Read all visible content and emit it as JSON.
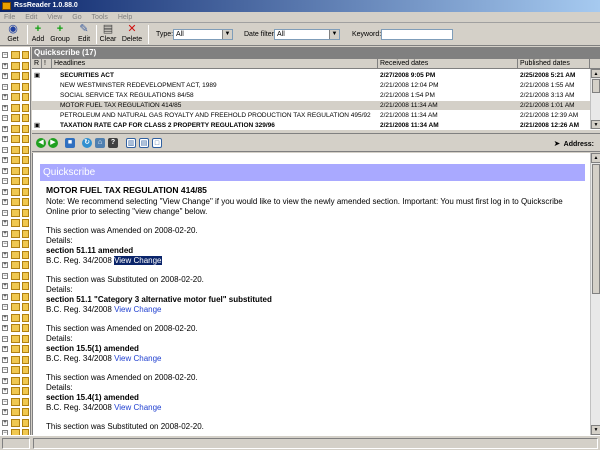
{
  "window": {
    "title": "RssReader 1.0.88.0"
  },
  "menu": [
    "File",
    "Edit",
    "View",
    "Go",
    "Tools",
    "Help"
  ],
  "toolbar": {
    "get": "Get",
    "add": "Add",
    "group": "Group",
    "edit": "Edit",
    "clear": "Clear",
    "delete": "Delete",
    "type_label": "Type:",
    "type_value": "All",
    "datefilter_label": "Date filter:",
    "datefilter_value": "All",
    "keyword_label": "Keyword:"
  },
  "feed_panel": {
    "title": "Quickscribe (17)"
  },
  "grid": {
    "columns": [
      "R",
      "!",
      "Headlines",
      "Received dates",
      "Published dates"
    ],
    "rows": [
      {
        "headline": "SECURITIES ACT",
        "received": "2/27/2008 9:05 PM",
        "published": "2/25/2008 5:21 AM"
      },
      {
        "headline": "NEW WESTMINSTER REDEVELOPMENT ACT, 1989",
        "received": "2/21/2008 12:04 PM",
        "published": "2/21/2008 1:55 AM"
      },
      {
        "headline": "SOCIAL SERVICE TAX REGULATIONS 84/58",
        "received": "2/21/2008 1:54 PM",
        "published": "2/21/2008 3:13 AM"
      },
      {
        "headline": "MOTOR FUEL TAX REGULATION 414/85",
        "received": "2/21/2008 11:34 AM",
        "published": "2/21/2008 1:01 AM"
      },
      {
        "headline": "PETROLEUM AND NATURAL GAS ROYALTY AND FREEHOLD PRODUCTION TAX REGULATION 495/92",
        "received": "2/21/2008 11:34 AM",
        "published": "2/21/2008 12:39 AM"
      },
      {
        "headline": "TAXATION RATE CAP FOR CLASS 2 PROPERTY REGULATION 329/96",
        "received": "2/21/2008 11:34 AM",
        "published": "2/21/2008 12:26 AM"
      }
    ]
  },
  "browser": {
    "address_label": "Address:"
  },
  "article": {
    "banner": "Quickscribe",
    "title": "MOTOR FUEL TAX REGULATION 414/85",
    "note": "Note: We recommend selecting \"View Change\" if you would like to view the newly amended section. Important: You must first log in to Quickscribe Online prior to selecting \"view change\" below.",
    "entries": [
      {
        "status": "This section was Amended on 2008-02-20.",
        "details": "Details:",
        "section": "section 51.11 amended",
        "reg": "B.C. Reg. 34/2008",
        "link": "View Change"
      },
      {
        "status": "This section was Substituted on 2008-02-20.",
        "details": "Details:",
        "section": "section 51.1 \"Category 3 alternative motor fuel\" substituted",
        "reg": "B.C. Reg. 34/2008",
        "link": "View Change"
      },
      {
        "status": "This section was Amended on 2008-02-20.",
        "details": "Details:",
        "section": "section 15.5(1) amended",
        "reg": "B.C. Reg. 34/2008",
        "link": "View Change"
      },
      {
        "status": "This section was Amended on 2008-02-20.",
        "details": "Details:",
        "section": "section 15.4(1) amended",
        "reg": "B.C. Reg. 34/2008",
        "link": "View Change"
      },
      {
        "status": "This section was Substituted on 2008-02-20."
      }
    ]
  },
  "colors": {
    "banner": "#a9a9ff",
    "link": "#1f3fd0",
    "selection": "#0a246a"
  }
}
